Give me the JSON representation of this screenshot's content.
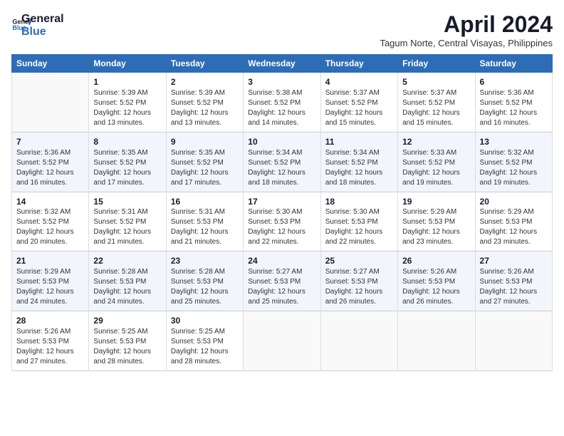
{
  "header": {
    "logo_line1": "General",
    "logo_line2": "Blue",
    "month_year": "April 2024",
    "location": "Tagum Norte, Central Visayas, Philippines"
  },
  "columns": [
    "Sunday",
    "Monday",
    "Tuesday",
    "Wednesday",
    "Thursday",
    "Friday",
    "Saturday"
  ],
  "weeks": [
    [
      {
        "day": "",
        "info": ""
      },
      {
        "day": "1",
        "info": "Sunrise: 5:39 AM\nSunset: 5:52 PM\nDaylight: 12 hours\nand 13 minutes."
      },
      {
        "day": "2",
        "info": "Sunrise: 5:39 AM\nSunset: 5:52 PM\nDaylight: 12 hours\nand 13 minutes."
      },
      {
        "day": "3",
        "info": "Sunrise: 5:38 AM\nSunset: 5:52 PM\nDaylight: 12 hours\nand 14 minutes."
      },
      {
        "day": "4",
        "info": "Sunrise: 5:37 AM\nSunset: 5:52 PM\nDaylight: 12 hours\nand 15 minutes."
      },
      {
        "day": "5",
        "info": "Sunrise: 5:37 AM\nSunset: 5:52 PM\nDaylight: 12 hours\nand 15 minutes."
      },
      {
        "day": "6",
        "info": "Sunrise: 5:36 AM\nSunset: 5:52 PM\nDaylight: 12 hours\nand 16 minutes."
      }
    ],
    [
      {
        "day": "7",
        "info": "Sunrise: 5:36 AM\nSunset: 5:52 PM\nDaylight: 12 hours\nand 16 minutes."
      },
      {
        "day": "8",
        "info": "Sunrise: 5:35 AM\nSunset: 5:52 PM\nDaylight: 12 hours\nand 17 minutes."
      },
      {
        "day": "9",
        "info": "Sunrise: 5:35 AM\nSunset: 5:52 PM\nDaylight: 12 hours\nand 17 minutes."
      },
      {
        "day": "10",
        "info": "Sunrise: 5:34 AM\nSunset: 5:52 PM\nDaylight: 12 hours\nand 18 minutes."
      },
      {
        "day": "11",
        "info": "Sunrise: 5:34 AM\nSunset: 5:52 PM\nDaylight: 12 hours\nand 18 minutes."
      },
      {
        "day": "12",
        "info": "Sunrise: 5:33 AM\nSunset: 5:52 PM\nDaylight: 12 hours\nand 19 minutes."
      },
      {
        "day": "13",
        "info": "Sunrise: 5:32 AM\nSunset: 5:52 PM\nDaylight: 12 hours\nand 19 minutes."
      }
    ],
    [
      {
        "day": "14",
        "info": "Sunrise: 5:32 AM\nSunset: 5:52 PM\nDaylight: 12 hours\nand 20 minutes."
      },
      {
        "day": "15",
        "info": "Sunrise: 5:31 AM\nSunset: 5:52 PM\nDaylight: 12 hours\nand 21 minutes."
      },
      {
        "day": "16",
        "info": "Sunrise: 5:31 AM\nSunset: 5:53 PM\nDaylight: 12 hours\nand 21 minutes."
      },
      {
        "day": "17",
        "info": "Sunrise: 5:30 AM\nSunset: 5:53 PM\nDaylight: 12 hours\nand 22 minutes."
      },
      {
        "day": "18",
        "info": "Sunrise: 5:30 AM\nSunset: 5:53 PM\nDaylight: 12 hours\nand 22 minutes."
      },
      {
        "day": "19",
        "info": "Sunrise: 5:29 AM\nSunset: 5:53 PM\nDaylight: 12 hours\nand 23 minutes."
      },
      {
        "day": "20",
        "info": "Sunrise: 5:29 AM\nSunset: 5:53 PM\nDaylight: 12 hours\nand 23 minutes."
      }
    ],
    [
      {
        "day": "21",
        "info": "Sunrise: 5:29 AM\nSunset: 5:53 PM\nDaylight: 12 hours\nand 24 minutes."
      },
      {
        "day": "22",
        "info": "Sunrise: 5:28 AM\nSunset: 5:53 PM\nDaylight: 12 hours\nand 24 minutes."
      },
      {
        "day": "23",
        "info": "Sunrise: 5:28 AM\nSunset: 5:53 PM\nDaylight: 12 hours\nand 25 minutes."
      },
      {
        "day": "24",
        "info": "Sunrise: 5:27 AM\nSunset: 5:53 PM\nDaylight: 12 hours\nand 25 minutes."
      },
      {
        "day": "25",
        "info": "Sunrise: 5:27 AM\nSunset: 5:53 PM\nDaylight: 12 hours\nand 26 minutes."
      },
      {
        "day": "26",
        "info": "Sunrise: 5:26 AM\nSunset: 5:53 PM\nDaylight: 12 hours\nand 26 minutes."
      },
      {
        "day": "27",
        "info": "Sunrise: 5:26 AM\nSunset: 5:53 PM\nDaylight: 12 hours\nand 27 minutes."
      }
    ],
    [
      {
        "day": "28",
        "info": "Sunrise: 5:26 AM\nSunset: 5:53 PM\nDaylight: 12 hours\nand 27 minutes."
      },
      {
        "day": "29",
        "info": "Sunrise: 5:25 AM\nSunset: 5:53 PM\nDaylight: 12 hours\nand 28 minutes."
      },
      {
        "day": "30",
        "info": "Sunrise: 5:25 AM\nSunset: 5:53 PM\nDaylight: 12 hours\nand 28 minutes."
      },
      {
        "day": "",
        "info": ""
      },
      {
        "day": "",
        "info": ""
      },
      {
        "day": "",
        "info": ""
      },
      {
        "day": "",
        "info": ""
      }
    ]
  ]
}
